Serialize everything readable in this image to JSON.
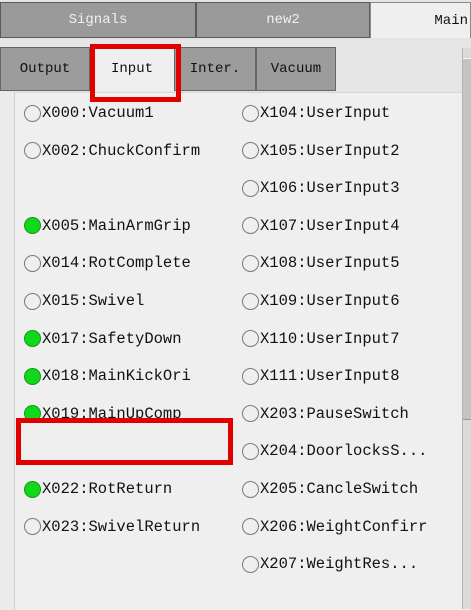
{
  "top_tabs": [
    {
      "label": "Signals",
      "active": false
    },
    {
      "label": "new2",
      "active": false
    },
    {
      "label": "Main",
      "active": true
    }
  ],
  "sub_tabs": [
    {
      "label": "Output",
      "active": false
    },
    {
      "label": "Input",
      "active": true
    },
    {
      "label": "Inter.",
      "active": false
    },
    {
      "label": "Vacuum",
      "active": false
    }
  ],
  "left_signals": [
    {
      "label": "X000:Vacuum1",
      "on": false
    },
    {
      "label": "X002:ChuckConfirm",
      "on": false
    },
    {
      "label": "X005:MainArmGrip",
      "on": true
    },
    {
      "label": "X014:RotComplete",
      "on": false
    },
    {
      "label": "X015:Swivel",
      "on": false
    },
    {
      "label": "X017:SafetyDown",
      "on": true
    },
    {
      "label": "X018:MainKickOri",
      "on": true
    },
    {
      "label": "X019:MainUpComp",
      "on": true
    },
    {
      "label": "X022:RotReturn",
      "on": true
    },
    {
      "label": "X023:SwivelReturn",
      "on": false
    }
  ],
  "right_signals": [
    {
      "label": "X104:UserInput",
      "on": false
    },
    {
      "label": "X105:UserInput2",
      "on": false
    },
    {
      "label": "X106:UserInput3",
      "on": false
    },
    {
      "label": "X107:UserInput4",
      "on": false
    },
    {
      "label": "X108:UserInput5",
      "on": false
    },
    {
      "label": "X109:UserInput6",
      "on": false
    },
    {
      "label": "X110:UserInput7",
      "on": false
    },
    {
      "label": "X111:UserInput8",
      "on": false
    },
    {
      "label": "X203:PauseSwitch",
      "on": false
    },
    {
      "label": "X204:DoorlocksS...",
      "on": false
    },
    {
      "label": "X205:CancleSwitch",
      "on": false
    },
    {
      "label": "X206:WeightConfirr",
      "on": false
    },
    {
      "label": "X207:WeightRes...",
      "on": false
    }
  ],
  "colors": {
    "lamp_on": "#11d81b",
    "highlight": "#e00000"
  }
}
